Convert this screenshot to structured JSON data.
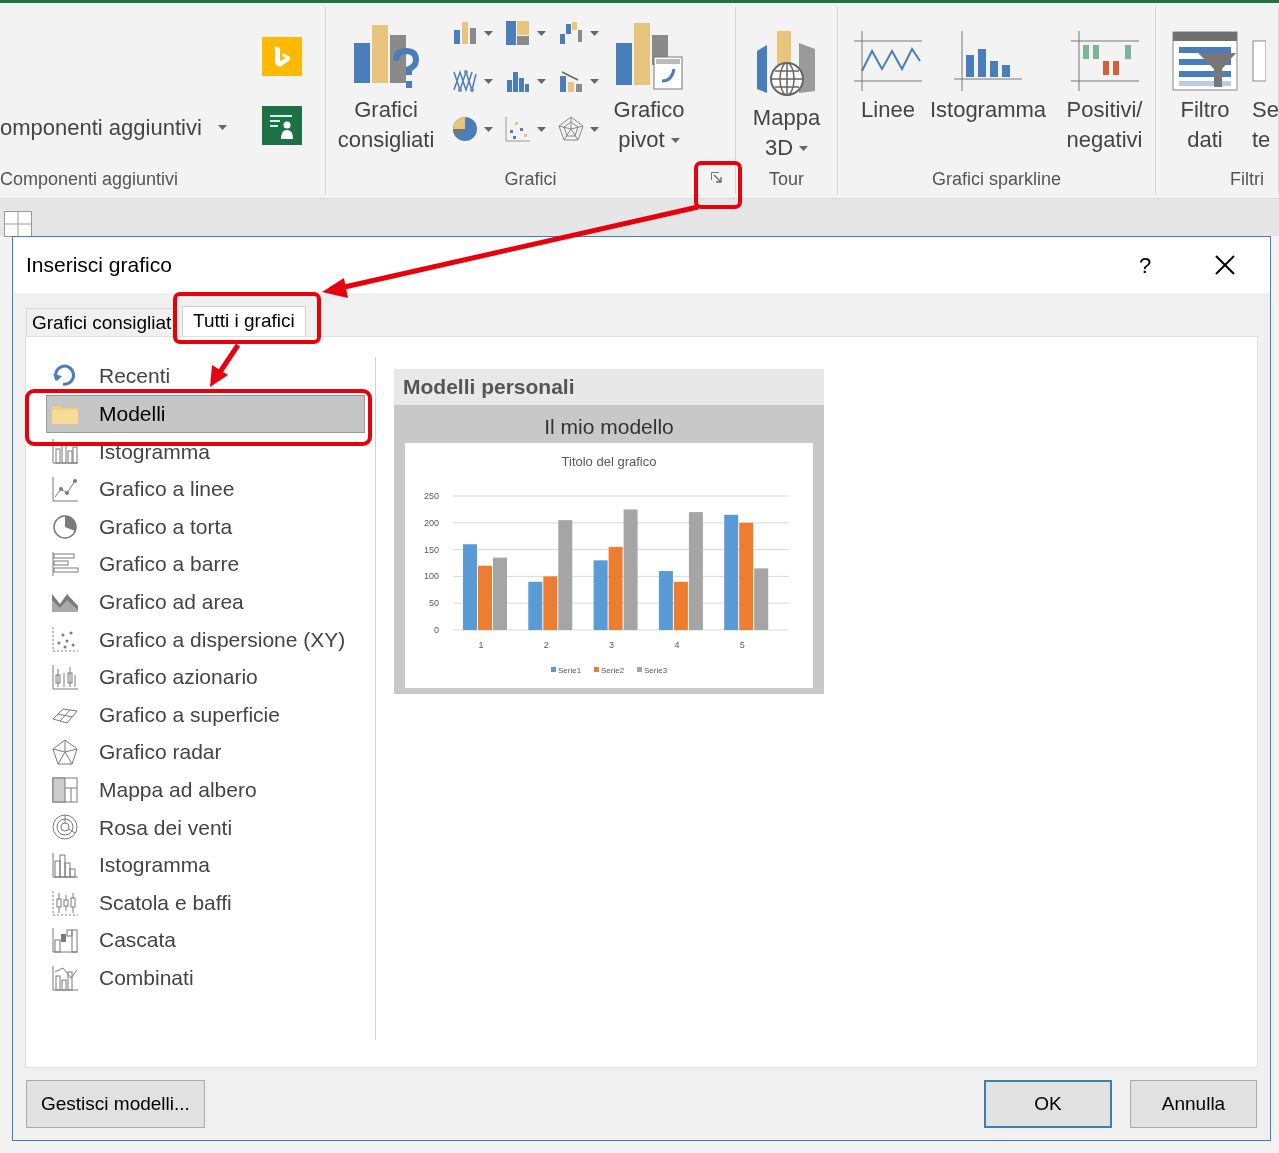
{
  "ribbon": {
    "groups": [
      {
        "kind": "addins",
        "label": "Componenti aggiuntivi",
        "items": [
          {
            "lines": [
              "omponenti aggiuntivi"
            ],
            "dropdown": true
          }
        ]
      },
      {
        "kind": "charts",
        "label": "Grafici",
        "items": [
          {
            "lines": [
              "Grafici",
              "consigliati"
            ],
            "dropdown": false
          },
          {
            "lines": [
              "Grafico",
              "pivot"
            ],
            "dropdown": true
          }
        ]
      },
      {
        "kind": "tour",
        "label": "Tour",
        "items": [
          {
            "lines": [
              "Mappa",
              "3D"
            ],
            "dropdown": true
          }
        ]
      },
      {
        "kind": "sparkline",
        "label": "Grafici sparkline",
        "items": [
          {
            "lines": [
              "Linee"
            ],
            "dropdown": false
          },
          {
            "lines": [
              "Istogramma"
            ],
            "dropdown": false
          },
          {
            "lines": [
              "Positivi/",
              "negativi"
            ],
            "dropdown": false
          }
        ]
      },
      {
        "kind": "filters",
        "label": "Filtri",
        "items": [
          {
            "lines": [
              "Filtro",
              "dati"
            ],
            "dropdown": false
          },
          {
            "lines": [
              "Se",
              "te"
            ],
            "dropdown": false
          }
        ]
      }
    ]
  },
  "dialog": {
    "title": "Inserisci grafico",
    "help": "?",
    "tabs": [
      {
        "label": "Grafici consigliat",
        "selected": false
      },
      {
        "label": "Tutti i grafici",
        "selected": true
      }
    ],
    "categories": [
      {
        "label": "Recenti",
        "selected": false
      },
      {
        "label": "Modelli",
        "selected": true
      },
      {
        "label": "Istogramma",
        "selected": false
      },
      {
        "label": "Grafico a linee",
        "selected": false
      },
      {
        "label": "Grafico a torta",
        "selected": false
      },
      {
        "label": "Grafico a barre",
        "selected": false
      },
      {
        "label": "Grafico ad area",
        "selected": false
      },
      {
        "label": "Grafico a dispersione (XY)",
        "selected": false
      },
      {
        "label": "Grafico azionario",
        "selected": false
      },
      {
        "label": "Grafico a superficie",
        "selected": false
      },
      {
        "label": "Grafico radar",
        "selected": false
      },
      {
        "label": "Mappa ad albero",
        "selected": false
      },
      {
        "label": "Rosa dei venti",
        "selected": false
      },
      {
        "label": "Istogramma",
        "selected": false
      },
      {
        "label": "Scatola e baffi",
        "selected": false
      },
      {
        "label": "Cascata",
        "selected": false
      },
      {
        "label": "Combinati",
        "selected": false
      }
    ],
    "section_title": "Modelli personali",
    "template": {
      "name": "Il mio modello",
      "chart_data": {
        "type": "bar",
        "title": "Titolo del grafico",
        "categories": [
          "1",
          "2",
          "3",
          "4",
          "5"
        ],
        "series": [
          {
            "name": "Serie1",
            "color": "#5b9bd5",
            "values": [
              160,
              90,
              130,
              110,
              215
            ]
          },
          {
            "name": "Serie2",
            "color": "#ed7d31",
            "values": [
              120,
              100,
              155,
              90,
              200
            ]
          },
          {
            "name": "Serie3",
            "color": "#a5a5a5",
            "values": [
              135,
              205,
              225,
              220,
              115
            ]
          }
        ],
        "ylim": [
          0,
          250
        ],
        "yticks": [
          0,
          50,
          100,
          150,
          200,
          250
        ],
        "legend": "bottom",
        "grid": true
      }
    },
    "buttons": [
      {
        "label": "Gestisci modelli...",
        "kind": "manage"
      },
      {
        "label": "OK",
        "kind": "default"
      },
      {
        "label": "Annulla",
        "kind": "normal"
      }
    ]
  }
}
